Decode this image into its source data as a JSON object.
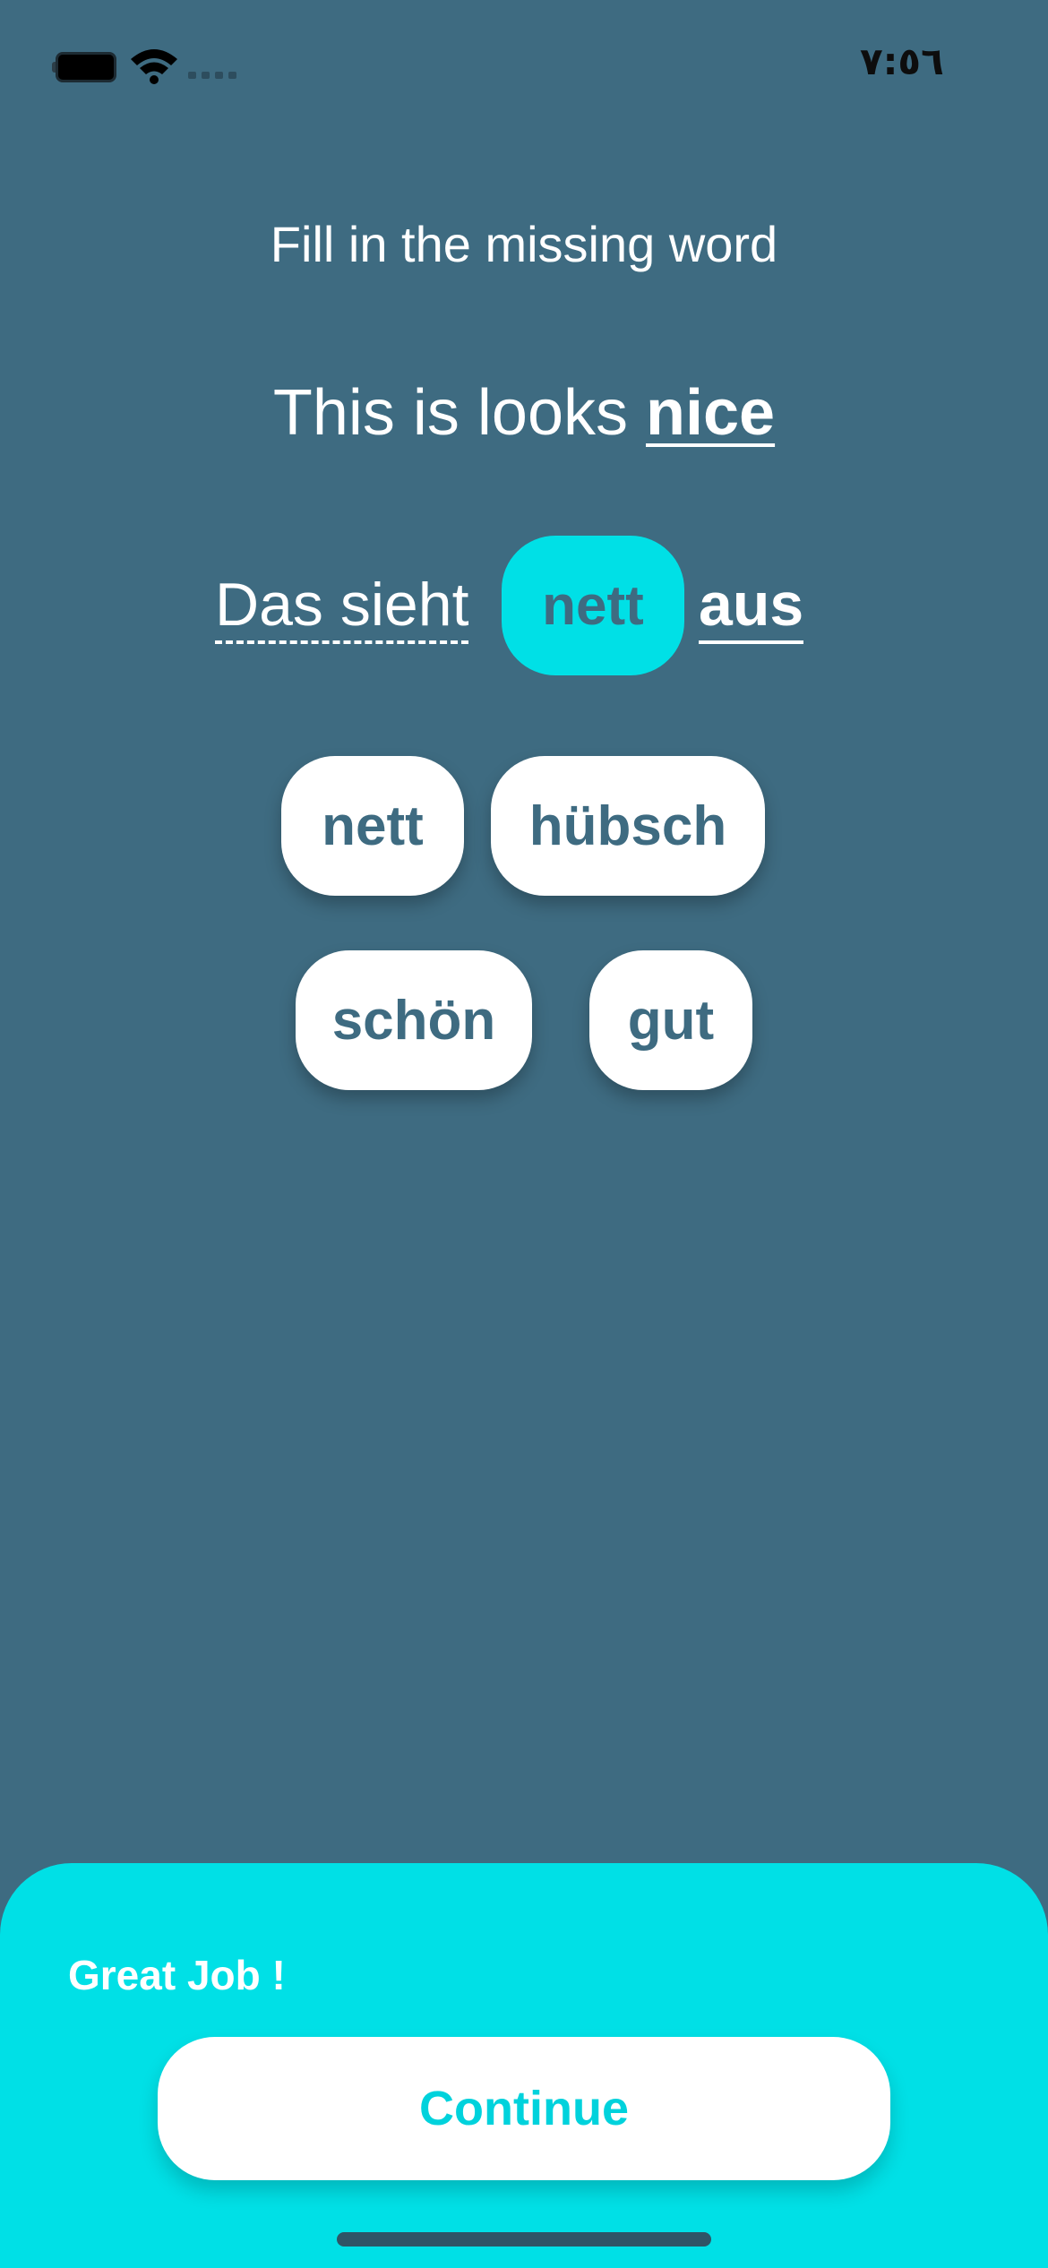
{
  "status_bar": {
    "time": "٧:٥٦",
    "battery_icon": "battery-icon",
    "wifi_icon": "wifi-icon",
    "signal_icon": "cellular-signal-icon"
  },
  "exercise": {
    "instruction": "Fill in the missing word",
    "source_prefix": "This is looks ",
    "source_target": "nice",
    "translation_prefix": "Das sieht",
    "translation_slot": "nett",
    "translation_suffix": "aus"
  },
  "options": [
    {
      "label": "nett"
    },
    {
      "label": "hübsch"
    },
    {
      "label": "schön"
    },
    {
      "label": "gut"
    }
  ],
  "feedback": {
    "title": "Great Job !",
    "continue_label": "Continue"
  },
  "colors": {
    "background": "#3e6b81",
    "accent": "#00e0e6",
    "chip": "#ffffff"
  }
}
